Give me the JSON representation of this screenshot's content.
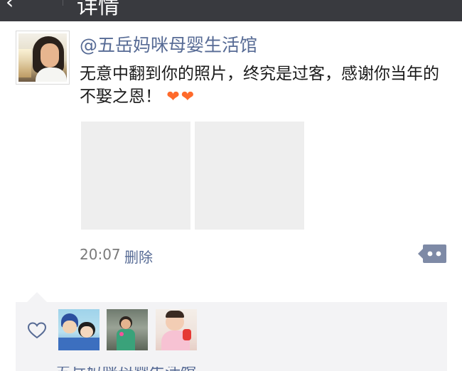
{
  "header": {
    "back_glyph": "‹",
    "title": "详情"
  },
  "post": {
    "username": "@五岳妈咪母婴生活馆",
    "text": "无意中翻到你的照片，终究是过客，感谢你当年的不娶之恩！",
    "hearts": "❤❤",
    "time": "20:07",
    "delete_label": "删除",
    "photos": [
      "photo-1",
      "photo-2"
    ]
  },
  "likes": {
    "icon": "heart-outline-icon",
    "count_avatars": 3
  },
  "comment_preview": {
    "text": "五岳妈咪母婴生活馆"
  },
  "colors": {
    "link": "#576b95",
    "topbar": "#393a3f",
    "likes_bg": "#f3f3f5",
    "hearts": "#ff6a2b",
    "more_button": "#7e8aa6"
  }
}
